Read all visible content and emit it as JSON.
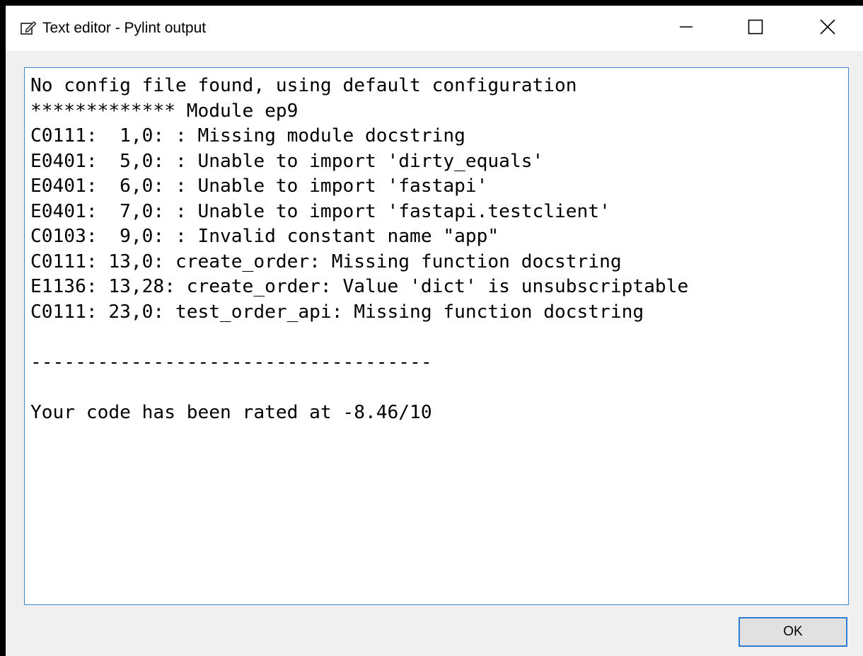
{
  "window": {
    "title": "Text editor - Pylint output"
  },
  "icons": {
    "title": "edit-note-icon",
    "minimize": "minimize-icon",
    "maximize": "maximize-icon",
    "close": "close-icon"
  },
  "editor": {
    "lines": [
      "No config file found, using default configuration",
      "************* Module ep9",
      "C0111:  1,0: : Missing module docstring",
      "E0401:  5,0: : Unable to import 'dirty_equals'",
      "E0401:  6,0: : Unable to import 'fastapi'",
      "E0401:  7,0: : Unable to import 'fastapi.testclient'",
      "C0103:  9,0: : Invalid constant name \"app\"",
      "C0111: 13,0: create_order: Missing function docstring",
      "E1136: 13,28: create_order: Value 'dict' is unsubscriptable",
      "C0111: 23,0: test_order_api: Missing function docstring",
      "",
      "------------------------------------",
      "",
      "Your code has been rated at -8.46/10"
    ]
  },
  "buttons": {
    "ok_label": "OK"
  },
  "colors": {
    "accent": "#2d7fd6",
    "border": "#3c86cf",
    "dialog_bg": "#f0f0f0"
  }
}
